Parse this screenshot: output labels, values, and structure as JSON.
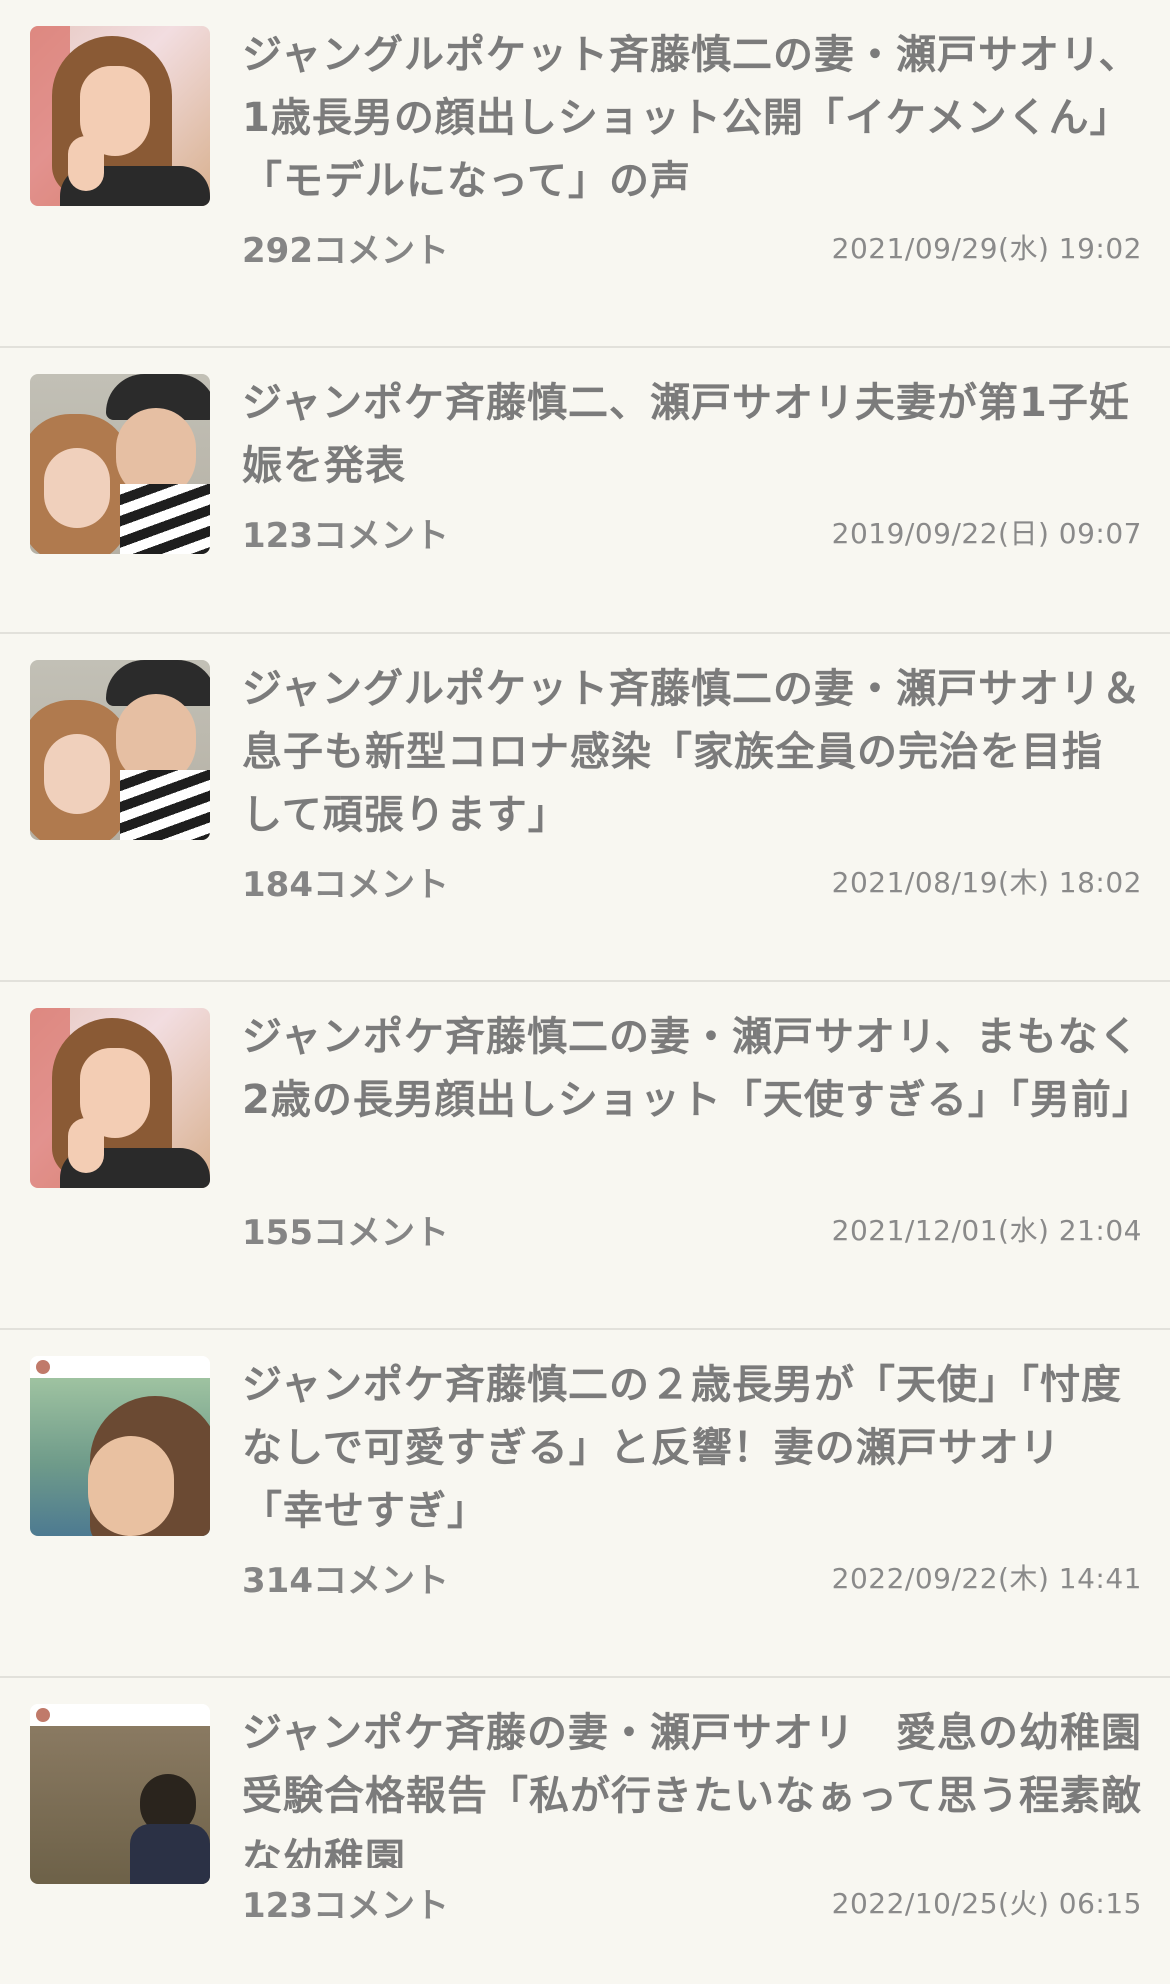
{
  "articles": [
    {
      "title": "ジャングルポケット斉藤慎二の妻・瀬戸サオリ、1歳長男の顔出しショット公開「イケメンくん」「モデルになって」の声",
      "comments": "292コメント",
      "date": "2021/09/29(水) 19:02",
      "thumbnail": "woman-peace-sign-photo"
    },
    {
      "title": "ジャンポケ斉藤慎二、瀬戸サオリ夫妻が第1子妊娠を発表",
      "comments": "123コメント",
      "date": "2019/09/22(日) 09:07",
      "thumbnail": "couple-selfie-photo"
    },
    {
      "title": "ジャングルポケット斉藤慎二の妻・瀬戸サオリ＆息子も新型コロナ感染「家族全員の完治を目指して頑張ります」",
      "comments": "184コメント",
      "date": "2021/08/19(木) 18:02",
      "thumbnail": "couple-selfie-photo"
    },
    {
      "title": "ジャンポケ斉藤慎二の妻・瀬戸サオリ、まもなく2歳の長男顔出しショット「天使すぎる」「男前」",
      "comments": "155コメント",
      "date": "2021/12/01(水) 21:04",
      "thumbnail": "woman-peace-sign-photo"
    },
    {
      "title": "ジャンポケ斉藤慎二の２歳長男が「天使」「忖度なしで可愛すぎる」と反響！妻の瀬戸サオリ「幸せすぎ」",
      "comments": "314コメント",
      "date": "2022/09/22(木) 14:41",
      "thumbnail": "child-profile-photo"
    },
    {
      "title": "ジャンポケ斉藤の妻・瀬戸サオリ　愛息の幼稚園受験合格報告「私が行きたいなぁって思う程素敵な幼稚園",
      "comments": "123コメント",
      "date": "2022/10/25(火) 06:15",
      "thumbnail": "child-back-photo"
    }
  ]
}
